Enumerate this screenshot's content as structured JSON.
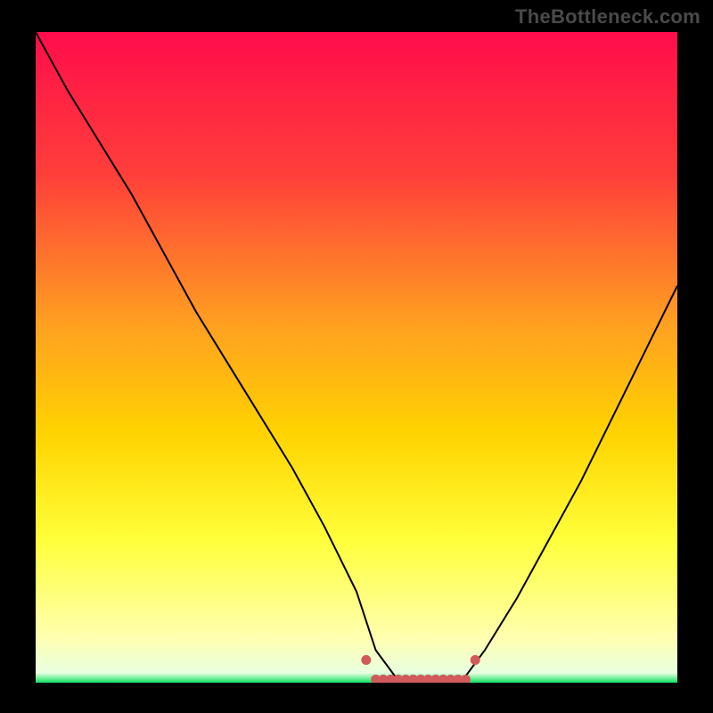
{
  "watermark": "TheBottleneck.com",
  "colors": {
    "frame": "#000000",
    "curve": "#000000",
    "marker": "#d15a5a",
    "gradient_stops": [
      {
        "offset": 0.0,
        "color": "#ff0d4b"
      },
      {
        "offset": 0.22,
        "color": "#ff3f3a"
      },
      {
        "offset": 0.45,
        "color": "#ffa020"
      },
      {
        "offset": 0.62,
        "color": "#ffd400"
      },
      {
        "offset": 0.78,
        "color": "#ffff3a"
      },
      {
        "offset": 0.93,
        "color": "#ffffaf"
      },
      {
        "offset": 0.985,
        "color": "#e8ffe0"
      },
      {
        "offset": 1.0,
        "color": "#10e060"
      }
    ]
  },
  "chart_data": {
    "type": "line",
    "title": "",
    "xlabel": "",
    "ylabel": "",
    "xlim": [
      0,
      100
    ],
    "ylim": [
      0,
      100
    ],
    "series": [
      {
        "name": "bottleneck-curve",
        "x": [
          0,
          5,
          10,
          15,
          20,
          25,
          30,
          35,
          40,
          45,
          50,
          53,
          56,
          60,
          64,
          67,
          70,
          75,
          80,
          85,
          90,
          95,
          100
        ],
        "y": [
          100,
          91,
          83,
          75,
          66,
          57,
          49,
          41,
          33,
          24,
          14,
          5,
          1,
          0,
          0,
          1,
          5,
          13,
          22,
          31,
          41,
          51,
          61
        ]
      }
    ],
    "marker_band": {
      "x_start": 53,
      "x_end": 67,
      "y": 0.5
    }
  }
}
